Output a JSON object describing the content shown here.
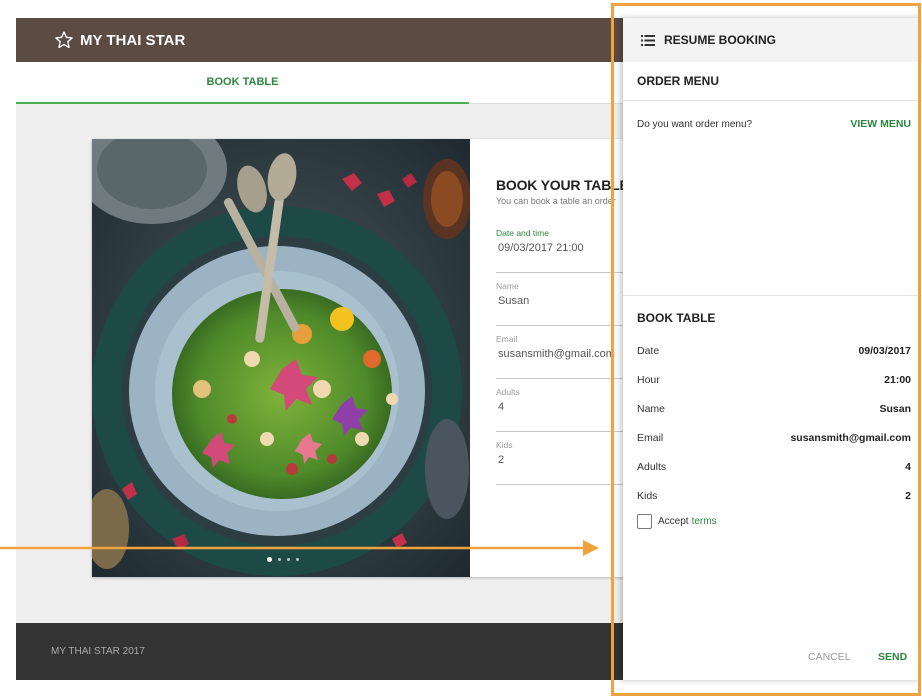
{
  "brand": {
    "name": "MY THAI STAR"
  },
  "tabs": {
    "book_table": "BOOK TABLE",
    "order": ""
  },
  "carousel": {
    "dots": 4,
    "active_index": 0
  },
  "booking_form": {
    "title": "BOOK YOUR TABLE",
    "subtitle": "You can book a table an order",
    "fields": [
      {
        "label": "Date and time",
        "value": "09/03/2017  21:00"
      },
      {
        "label": "Name",
        "value": "Susan"
      },
      {
        "label": "Email",
        "value": "susansmith@gmail.com"
      },
      {
        "label": "Adults",
        "value": "4"
      },
      {
        "label": "Kids",
        "value": "2"
      }
    ]
  },
  "footer": {
    "text": "MY THAI STAR 2017"
  },
  "panel": {
    "title": "RESUME BOOKING",
    "order_menu": {
      "title": "ORDER MENU",
      "question": "Do you want order menu?",
      "action": "VIEW MENU"
    },
    "book_table": {
      "title": "BOOK TABLE",
      "rows": [
        {
          "key": "Date",
          "value": "09/03/2017"
        },
        {
          "key": "Hour",
          "value": "21:00"
        },
        {
          "key": "Name",
          "value": "Susan"
        },
        {
          "key": "Email",
          "value": "susansmith@gmail.com"
        },
        {
          "key": "Adults",
          "value": "4"
        },
        {
          "key": "Kids",
          "value": "2"
        }
      ]
    },
    "accept_label": "Accept",
    "terms_label": "terms",
    "accept_checked": false,
    "cancel_label": "CANCEL",
    "send_label": "SEND"
  },
  "colors": {
    "topbar": "#5b4b43",
    "accent_green": "#2e8540",
    "footer": "#333333",
    "highlight_orange": "#f0a23e"
  }
}
